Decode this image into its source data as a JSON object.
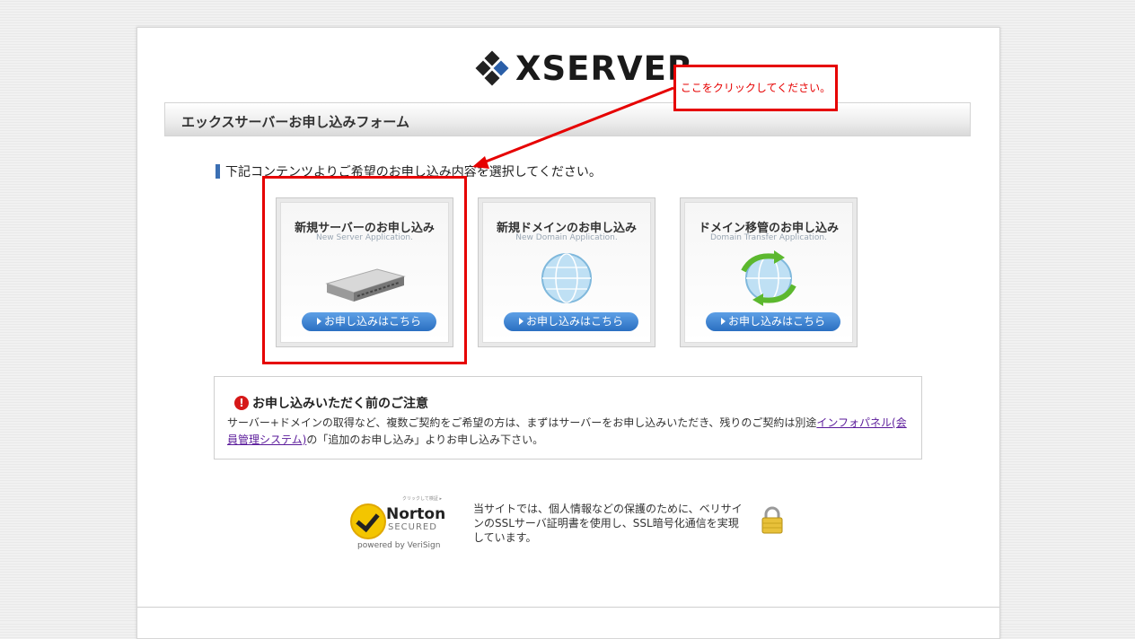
{
  "logo": {
    "text": "XSERVER"
  },
  "form_header": {
    "title": "エックスサーバーお申し込みフォーム"
  },
  "instruction": {
    "text": "下記コンテンツよりご希望のお申し込み内容を選択してください。"
  },
  "cards": [
    {
      "title": "新規サーバーのお申し込み",
      "subtitle": "New Server Application.",
      "icon": "server-icon",
      "button": "お申し込みはこちら"
    },
    {
      "title": "新規ドメインのお申し込み",
      "subtitle": "New Domain Application.",
      "icon": "globe-icon",
      "button": "お申し込みはこちら"
    },
    {
      "title": "ドメイン移管のお申し込み",
      "subtitle": "Domain Transfer Application.",
      "icon": "globe-transfer-icon",
      "button": "お申し込みはこちら"
    }
  ],
  "notice": {
    "icon": "!",
    "title": "お申し込みいただく前のご注意",
    "body_before": "サーバー+ドメインの取得など、複数ご契約をご希望の方は、まずはサーバーをお申し込みいただき、残りのご契約は別途",
    "link_text": "インフォパネル(会員管理システム)",
    "body_after": "の「追加のお申し込み」よりお申し込み下さい。"
  },
  "norton": {
    "top_text": "クリックして検証 ▸",
    "name": "Norton",
    "secured": "SECURED",
    "powered_by": "powered by VeriSign"
  },
  "ssl_text": "当サイトでは、個人情報などの保護のために、ベリサインのSSLサーバ証明書を使用し、SSL暗号化通信を実現しています。",
  "annotation": {
    "text": "ここをクリックしてください。",
    "color": "#e60000"
  },
  "colors": {
    "accent": "#2a6fc1",
    "annotation": "#e60000",
    "logo_blue": "#2b5fa8"
  }
}
